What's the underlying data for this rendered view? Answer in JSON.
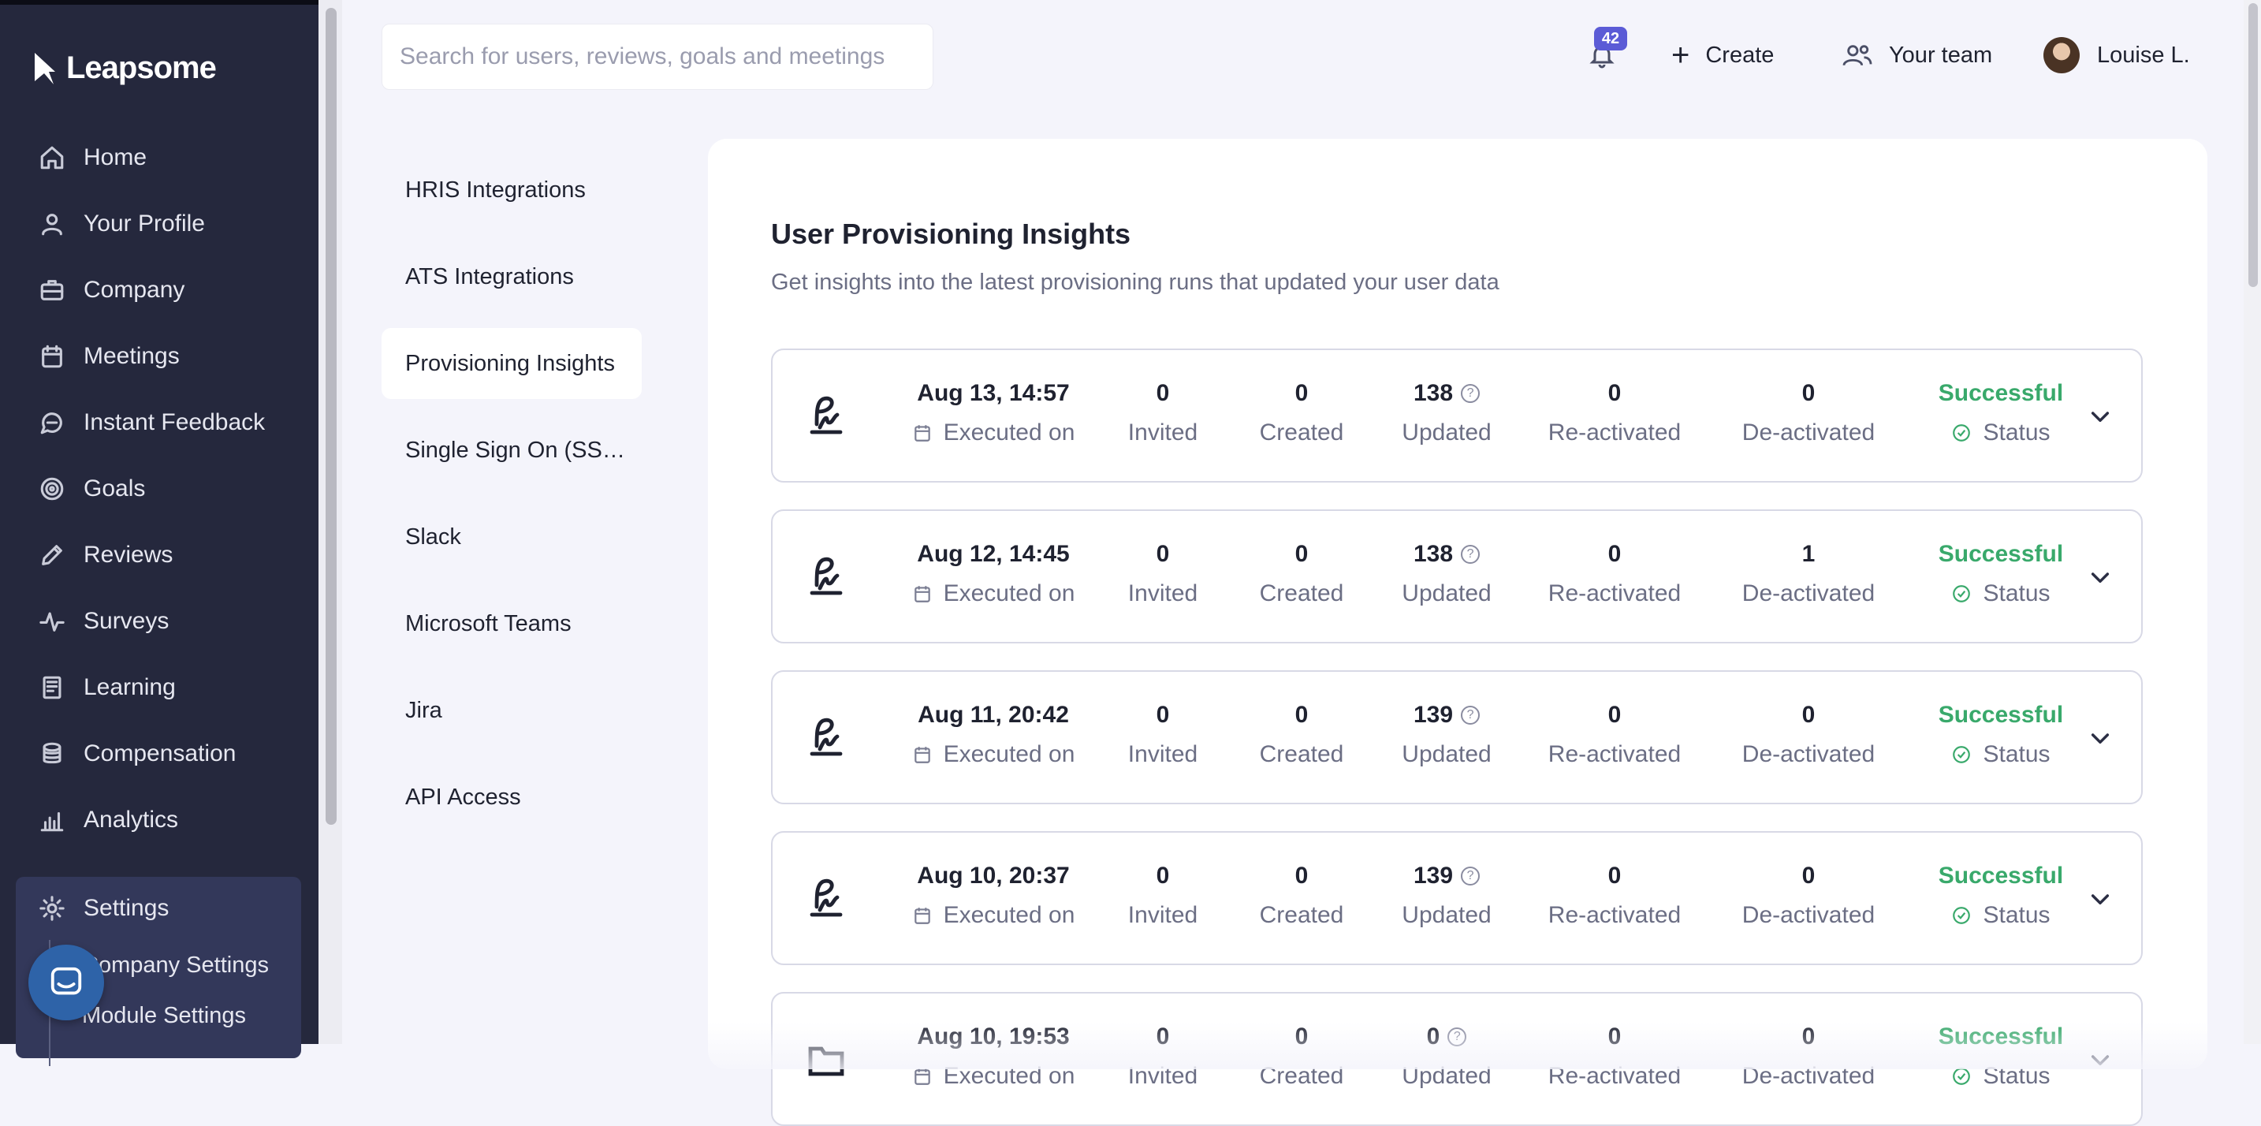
{
  "app": {
    "name": "Leapsome"
  },
  "sidebar": {
    "items": [
      {
        "label": "Home",
        "icon": "home-icon"
      },
      {
        "label": "Your Profile",
        "icon": "user-icon"
      },
      {
        "label": "Company",
        "icon": "briefcase-icon"
      },
      {
        "label": "Meetings",
        "icon": "calendar-icon"
      },
      {
        "label": "Instant Feedback",
        "icon": "chat-icon"
      },
      {
        "label": "Goals",
        "icon": "target-icon"
      },
      {
        "label": "Reviews",
        "icon": "pencil-icon"
      },
      {
        "label": "Surveys",
        "icon": "pulse-icon"
      },
      {
        "label": "Learning",
        "icon": "book-icon"
      },
      {
        "label": "Compensation",
        "icon": "coins-icon"
      },
      {
        "label": "Analytics",
        "icon": "chart-icon"
      }
    ],
    "settings": {
      "label": "Settings",
      "sub_items": [
        "Company Settings",
        "Module Settings"
      ]
    }
  },
  "topbar": {
    "search_placeholder": "Search for users, reviews, goals and meetings",
    "notifications_count": "42",
    "create_label": "Create",
    "team_label": "Your team",
    "user_name": "Louise L."
  },
  "subnav": {
    "items": [
      "HRIS Integrations",
      "ATS Integrations",
      "Provisioning Insights",
      "Single Sign On (SS…",
      "Slack",
      "Microsoft Teams",
      "Jira",
      "API Access"
    ],
    "active_index": 2
  },
  "main": {
    "title": "User Provisioning Insights",
    "subtitle": "Get insights into the latest provisioning runs that updated your user data",
    "labels": {
      "executed_on": "Executed on",
      "invited": "Invited",
      "created": "Created",
      "updated": "Updated",
      "reactivated": "Re-activated",
      "deactivated": "De-activated",
      "status": "Status"
    },
    "runs": [
      {
        "date": "Aug 13, 14:57",
        "invited": "0",
        "created": "0",
        "updated": "138",
        "reactivated": "0",
        "deactivated": "0",
        "status": "Successful",
        "source_icon": "signature-icon"
      },
      {
        "date": "Aug 12, 14:45",
        "invited": "0",
        "created": "0",
        "updated": "138",
        "reactivated": "0",
        "deactivated": "1",
        "status": "Successful",
        "source_icon": "signature-icon"
      },
      {
        "date": "Aug 11, 20:42",
        "invited": "0",
        "created": "0",
        "updated": "139",
        "reactivated": "0",
        "deactivated": "0",
        "status": "Successful",
        "source_icon": "signature-icon"
      },
      {
        "date": "Aug 10, 20:37",
        "invited": "0",
        "created": "0",
        "updated": "139",
        "reactivated": "0",
        "deactivated": "0",
        "status": "Successful",
        "source_icon": "signature-icon"
      },
      {
        "date": "Aug 10, 19:53",
        "invited": "0",
        "created": "0",
        "updated": "0",
        "reactivated": "0",
        "deactivated": "0",
        "status": "Successful",
        "source_icon": "folder-icon"
      }
    ]
  },
  "colors": {
    "sidebar_bg": "#25283d",
    "settings_bg": "#33385a",
    "accent_badge": "#5b5bd6",
    "success": "#39a96b",
    "page_bg": "#f4f4fb"
  }
}
